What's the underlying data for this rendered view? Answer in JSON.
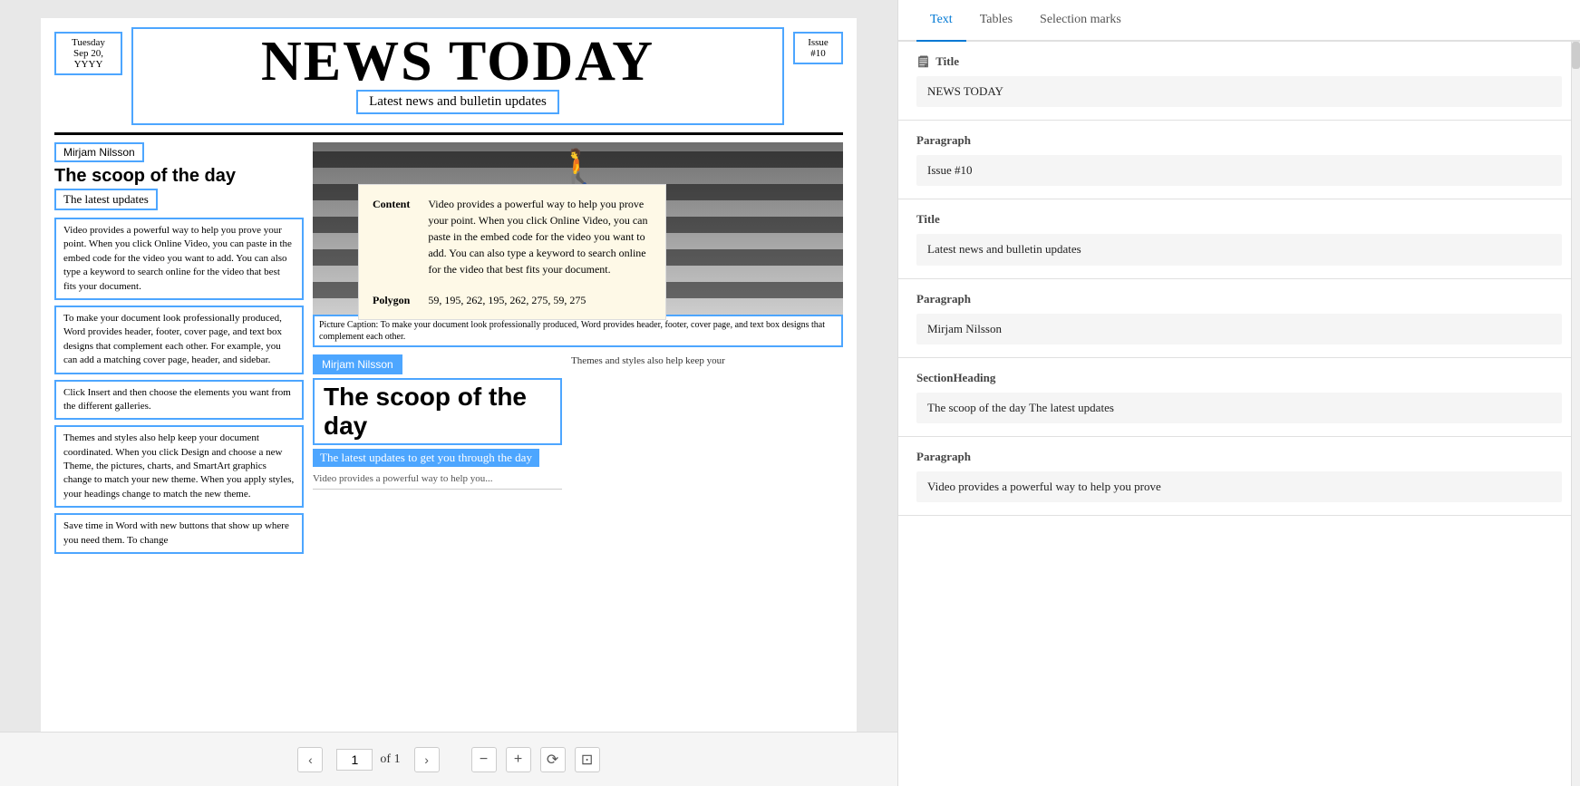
{
  "document": {
    "date": "Tuesday\nSep 20,\nYYYY",
    "title": "NEWS TODAY",
    "tagline": "Latest news and bulletin updates",
    "issue": "Issue\n#10",
    "author1": "Mirjam Nilsson",
    "section_heading": "The scoop of the day",
    "section_subheading": "The latest updates",
    "text_block1": "Video provides a powerful way to help you prove your point. When you click Online Video, you can paste in the embed code for the video you want to add. You can also type a keyword to search online for the video that best fits your document.",
    "text_block2": "To make your document look professionally produced, Word provides header, footer, cover page, and text box designs that complement each other. For example, you can add a matching cover page, header, and sidebar.",
    "text_block3": "Click Insert and then choose the elements you want from the different galleries.",
    "text_block4": "Themes and styles also help keep your document coordinated. When you click Design and choose a new Theme, the pictures, charts, and SmartArt graphics change to match your new theme. When you apply styles, your headings change to match the new theme.",
    "text_block5": "Save time in Word with new buttons that show up where you need them. To change",
    "tooltip": {
      "content_label": "Content",
      "content_text": "Video provides a powerful way to help you prove your point. When you click Online Video, you can paste in the embed code for the video you want to add. You can also type a keyword to search online for the video that best fits your document.",
      "polygon_label": "Polygon",
      "polygon_value": "59, 195, 262, 195, 262, 275, 59, 275"
    },
    "caption": "Picture Caption: To make your document look professionally produced, Word provides header, footer, cover page, and text box designs that complement each other.",
    "author2": "Mirjam Nilsson",
    "section_heading2": "The scoop of the day",
    "section_subheading2": "The latest updates to get you through the day",
    "lower_right_text": "Themes and styles also help keep your",
    "page_current": "1",
    "page_of": "of 1"
  },
  "right_panel": {
    "tabs": [
      {
        "id": "text",
        "label": "Text",
        "active": true
      },
      {
        "id": "tables",
        "label": "Tables",
        "active": false
      },
      {
        "id": "selection-marks",
        "label": "Selection marks",
        "active": false
      }
    ],
    "sections": [
      {
        "id": "title1",
        "label": "Title",
        "value": "NEWS TODAY"
      },
      {
        "id": "paragraph1",
        "label": "Paragraph",
        "value": "Issue #10"
      },
      {
        "id": "title2",
        "label": "Title",
        "value": "Latest news and bulletin updates"
      },
      {
        "id": "paragraph2",
        "label": "Paragraph",
        "value": "Mirjam Nilsson"
      },
      {
        "id": "section-heading",
        "label": "SectionHeading",
        "value": "The scoop of the day The latest updates"
      },
      {
        "id": "paragraph3",
        "label": "Paragraph",
        "value": "Video provides a powerful way to help you prove"
      }
    ]
  },
  "toolbar": {
    "prev_label": "‹",
    "next_label": "›",
    "zoom_out_label": "−",
    "zoom_in_label": "+",
    "rotate_label": "⟳",
    "fit_label": "⊡"
  }
}
